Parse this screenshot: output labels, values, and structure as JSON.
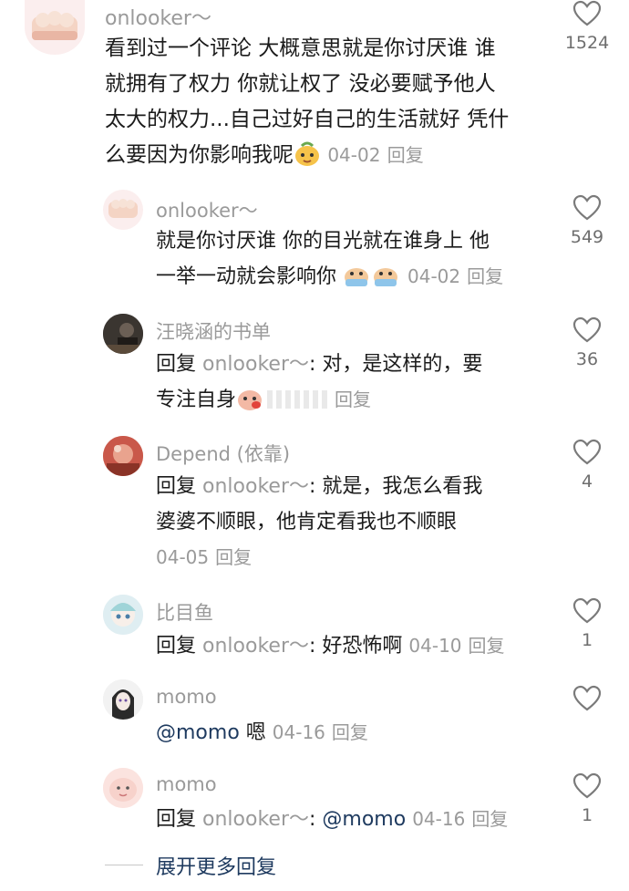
{
  "comments": [
    {
      "username": "onlooker～",
      "lines": [
        "看到过一个评论 大概意思就是你讨厌谁 谁",
        "就拥有了权力 你就让权了 没必要赋予他人",
        "太大的权力...自己过好自己的生活就好 凭什",
        "么要因为你影响我呢"
      ],
      "date": "04-02",
      "reply_label": "回复",
      "likes": "1524"
    },
    {
      "username": "onlooker～",
      "lines": [
        "就是你讨厌谁 你的目光就在谁身上 他",
        "一举一动就会影响你"
      ],
      "date": "04-02",
      "reply_label": "回复",
      "likes": "549"
    },
    {
      "username": "汪晓涵的书单",
      "reply_prefix": "回复",
      "reply_to": "onlooker～",
      "lines": [
        ": 对，是这样的，要",
        "专注自身"
      ],
      "reply_label": "回复",
      "likes": "36"
    },
    {
      "username": "Depend (依靠)",
      "reply_prefix": "回复",
      "reply_to": "onlooker～",
      "lines": [
        ": 就是，我怎么看我",
        "婆婆不顺眼，他肯定看我也不顺眼"
      ],
      "date": "04-05",
      "reply_label": "回复",
      "likes": "4"
    },
    {
      "username": "比目鱼",
      "reply_prefix": "回复",
      "reply_to": "onlooker～",
      "text": ": 好恐怖啊",
      "date": "04-10",
      "reply_label": "回复",
      "likes": "1"
    },
    {
      "username": "momo",
      "mention": "@momo",
      "text": " 嗯",
      "date": "04-16",
      "reply_label": "回复",
      "likes": ""
    },
    {
      "username": "momo",
      "reply_prefix": "回复",
      "reply_to": "onlooker～",
      "colon": ": ",
      "mention": "@momo",
      "date": "04-16",
      "reply_label": "回复",
      "likes": "1"
    }
  ],
  "expand_more": "展开更多回复",
  "colors": {
    "meta_gray": "#9a9a9a",
    "link_blue": "#1e3a5f",
    "text": "#1b1b1b"
  }
}
